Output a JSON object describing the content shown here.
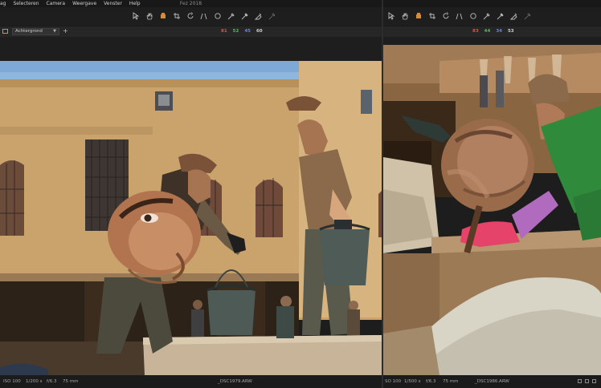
{
  "app": {
    "title": "Fez 2018"
  },
  "menu": {
    "items": [
      "ag",
      "Selecteren",
      "Camera",
      "Weergave",
      "Venster",
      "Help"
    ]
  },
  "tools": [
    {
      "name": "select-arrow-icon",
      "symbol": "arrow"
    },
    {
      "name": "pan-hand-icon",
      "symbol": "hand"
    },
    {
      "name": "brush-tool-icon",
      "symbol": "orange-brush"
    },
    {
      "name": "crop-icon",
      "symbol": "crop"
    },
    {
      "name": "rotate-icon",
      "symbol": "rotate"
    },
    {
      "name": "perspective-icon",
      "symbol": "keystone"
    },
    {
      "name": "circle-mask-icon",
      "symbol": "circle"
    },
    {
      "name": "color-picker-icon",
      "symbol": "dropper"
    },
    {
      "name": "white-balance-picker-icon",
      "symbol": "dropper2"
    },
    {
      "name": "erase-icon",
      "symbol": "eraser"
    },
    {
      "name": "gradient-icon",
      "symbol": "gradient"
    }
  ],
  "left": {
    "layer": {
      "selected": "Achtergrond",
      "add_label": "+"
    },
    "readout": {
      "r": "81",
      "g": "52",
      "b": "45",
      "l": "60"
    },
    "status": {
      "iso": "ISO 100",
      "shutter": "1/200 s",
      "aperture": "f/6.3",
      "focal": "75 mm",
      "filename": "_DSC1979.ARW"
    }
  },
  "right": {
    "readout": {
      "r": "83",
      "g": "44",
      "b": "34",
      "l": "53"
    },
    "status": {
      "iso": "SO 100",
      "shutter": "1/500 s",
      "aperture": "f/6.3",
      "focal": "75 mm",
      "filename": "_DSC1986.ARW"
    }
  },
  "colors": {
    "accent": "#e08a2c",
    "red": "#e0524a",
    "green": "#59b957",
    "blue": "#6a84e8"
  }
}
